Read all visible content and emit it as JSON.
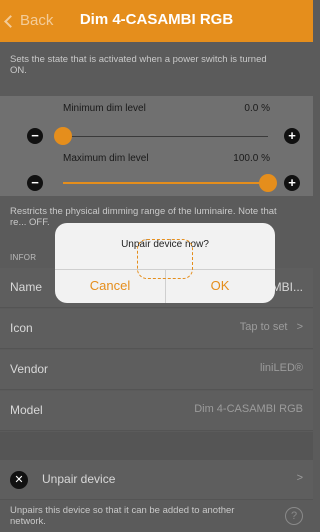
{
  "navbar": {
    "back_label": "Back",
    "title": "Dim 4-CASAMBI RGB"
  },
  "state_description": "Sets the state that is activated when a power switch is turned ON.",
  "dimming": {
    "min_label": "Minimum dim level",
    "min_value": "0.0 %",
    "min_fraction": 0.0,
    "max_label": "Maximum dim level",
    "max_value": "100.0 %",
    "max_fraction": 1.0,
    "restrict_description": "Restricts the physical dimming range of the luminaire. Note that re... OFF."
  },
  "info_header": "INFOR",
  "info_rows": {
    "name_label": "Name",
    "name_value": "MBI...",
    "icon_label": "Icon",
    "icon_value": "Tap to set",
    "vendor_label": "Vendor",
    "vendor_value": "liniLED®",
    "model_label": "Model",
    "model_value": "Dim 4-CASAMBI RGB"
  },
  "unpair": {
    "label": "Unpair device",
    "description": "Unpairs this device so that it can be added to another network."
  },
  "dialog": {
    "title": "Unpair device now?",
    "cancel_label": "Cancel",
    "ok_label": "OK"
  },
  "icons": {
    "back": "chevron-left-icon",
    "minus": "minus-circle-icon",
    "plus": "plus-circle-icon",
    "chevron": "chevron-right-icon",
    "unpair": "close-circle-icon",
    "help": "help-circle-icon"
  },
  "colors": {
    "accent": "#e58e1c",
    "overlay_background": "#5b5b5b",
    "dialog_background": "#f2f2f2"
  }
}
